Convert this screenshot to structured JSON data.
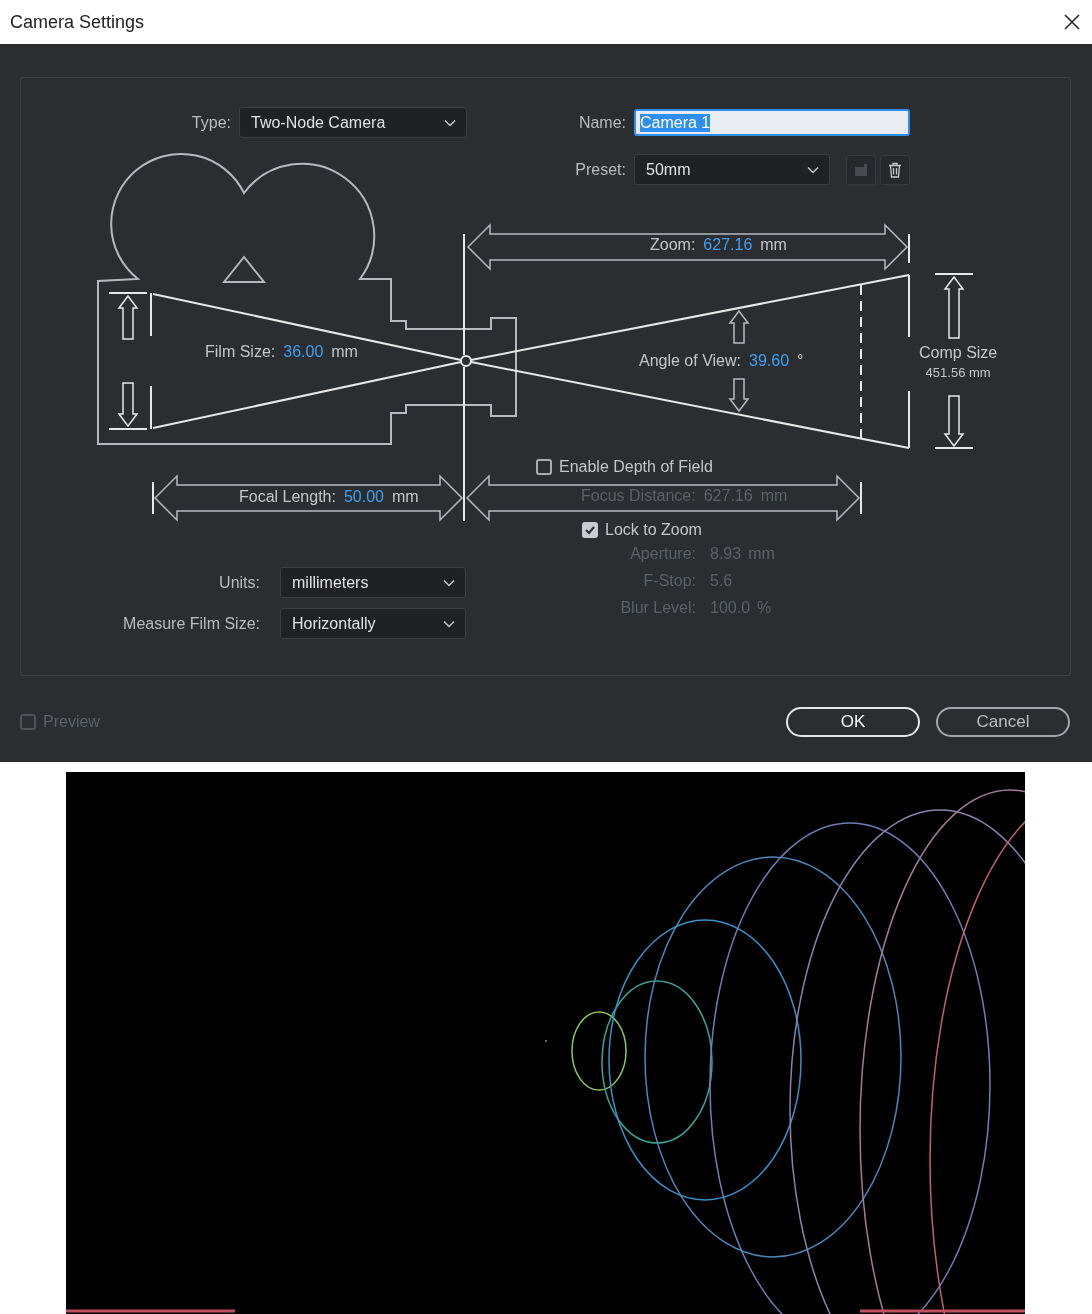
{
  "window": {
    "title": "Camera Settings"
  },
  "type": {
    "label": "Type:",
    "value": "Two-Node Camera"
  },
  "name": {
    "label": "Name:",
    "value": "Camera 1",
    "text_selected": true
  },
  "preset": {
    "label": "Preset:",
    "value": "50mm",
    "save_disabled": true
  },
  "diagram": {
    "film_size": {
      "label": "Film Size:",
      "value": "36.00",
      "unit": "mm"
    },
    "zoom": {
      "label": "Zoom:",
      "value": "627.16",
      "unit": "mm"
    },
    "angle_of_view": {
      "label": "Angle of View:",
      "value": "39.60",
      "unit": "°"
    },
    "comp_size": {
      "label": "Comp Size",
      "value": "451.56 mm"
    },
    "focal_length": {
      "label": "Focal Length:",
      "value": "50.00",
      "unit": "mm"
    },
    "focus_distance": {
      "label": "Focus Distance:",
      "value": "627.16",
      "unit": "mm",
      "disabled": true
    }
  },
  "depth_of_field": {
    "label": "Enable Depth of Field",
    "checked": false
  },
  "lock_to_zoom": {
    "label": "Lock to Zoom",
    "checked": true
  },
  "dof_fields": [
    {
      "label": "Aperture:",
      "value": "8.93",
      "unit": "mm",
      "disabled": true
    },
    {
      "label": "F-Stop:",
      "value": "5.6",
      "disabled": true
    },
    {
      "label": "Blur Level:",
      "value": "100.0",
      "unit": "%",
      "disabled": true
    }
  ],
  "units": {
    "label": "Units:",
    "value": "millimeters"
  },
  "measure_film_size": {
    "label": "Measure Film Size:",
    "value": "Horizontally"
  },
  "preview": {
    "label": "Preview",
    "checked": false,
    "disabled": true
  },
  "buttons": [
    {
      "label": "OK",
      "default": true
    },
    {
      "label": "Cancel",
      "default": false
    }
  ]
}
